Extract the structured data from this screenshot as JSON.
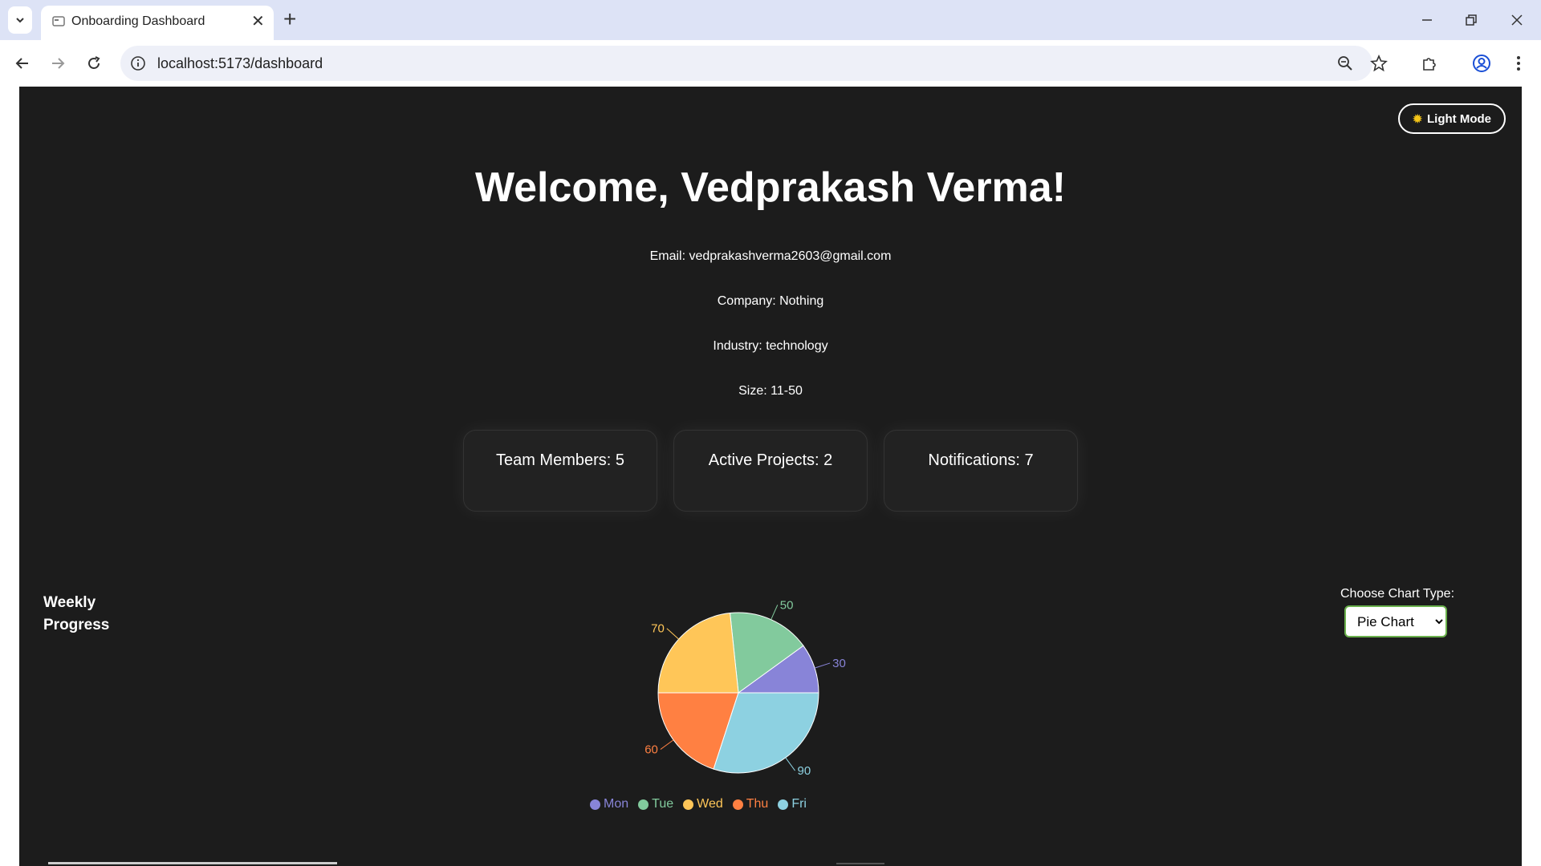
{
  "browser": {
    "tab_title": "Onboarding Dashboard",
    "url": "localhost:5173/dashboard"
  },
  "header": {
    "mode_button_label": "Light Mode",
    "mode_button_icon": "sun-icon"
  },
  "welcome": {
    "title": "Welcome, Vedprakash Verma!",
    "email": "Email: vedprakashverma2603@gmail.com",
    "company": "Company: Nothing",
    "industry": "Industry: technology",
    "size": "Size: 11-50"
  },
  "cards": [
    {
      "label": "Team Members: 5"
    },
    {
      "label": "Active Projects: 2"
    },
    {
      "label": "Notifications: 7"
    }
  ],
  "progress": {
    "heading": "Weekly Progress",
    "chart_type_label": "Choose Chart Type:",
    "chart_type_selected": "Pie Chart"
  },
  "chart_data": {
    "type": "pie",
    "title": "",
    "categories": [
      "Mon",
      "Tue",
      "Wed",
      "Thu",
      "Fri"
    ],
    "values": [
      30,
      50,
      70,
      60,
      90
    ],
    "colors": [
      "#8884d8",
      "#82ca9d",
      "#ffc658",
      "#ff8042",
      "#8dd1e1"
    ],
    "legend": "bottom"
  }
}
